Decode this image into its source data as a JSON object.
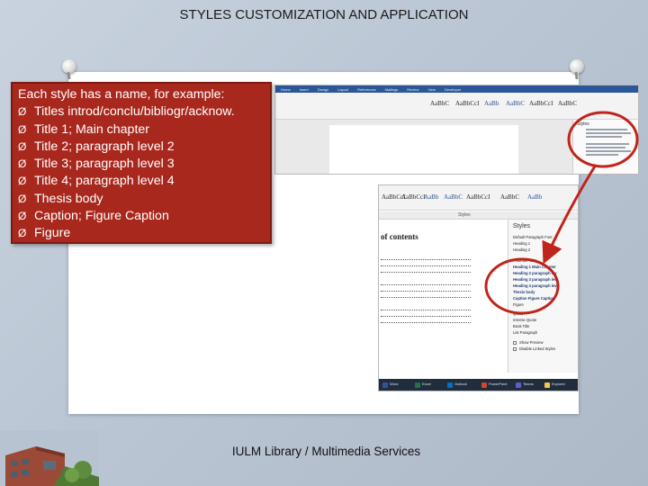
{
  "slide": {
    "title": "STYLES CUSTOMIZATION AND APPLICATION",
    "footer": "IULM Library / Multimedia Services"
  },
  "callout": {
    "intro": "Each style has a name, for example:",
    "items": [
      "Titles introd/conclu/bibliogr/acknow.",
      "Title 1; Main chapter",
      "Title 2; paragraph level 2",
      "Title 3; paragraph level 3",
      "Title 4; paragraph level 4",
      "Thesis body",
      "Caption; Figure Caption",
      "Figure"
    ],
    "bullet": "Ø",
    "color": "#a9281e"
  },
  "word1": {
    "tabs": [
      "Home",
      "Insert",
      "Design",
      "Layout",
      "References",
      "Mailings",
      "Review",
      "View",
      "Developer"
    ],
    "style_chips": [
      "AaBbC",
      "AaBbCcI",
      "AaBb",
      "AaBbC",
      "AaBbCcI",
      "AaBbC"
    ],
    "pane_title": "Styles"
  },
  "word2": {
    "toc_title": "of contents",
    "style_chips": [
      "AaBbCcI",
      "AaBbCcI",
      "AaBb",
      "AaBbC",
      "AaBbCcI",
      "AaBbC",
      "AaBb"
    ],
    "section_label": "Styles",
    "styles_pane_title": "Styles",
    "style_names": [
      "Default Paragraph Font",
      "Heading 1",
      "Heading 2",
      "Footnote Text",
      "Heading 1 Main Chapter",
      "Heading 2 paragraph lev",
      "Heading 3 paragraph lev",
      "Heading 4 paragraph lev",
      "Thesis body",
      "Caption Figure Caption",
      "Figure",
      "Quote",
      "Intense Quote",
      "Book Title",
      "List Paragraph"
    ],
    "checkboxes": [
      "Show Preview",
      "Disable Linked Styles"
    ],
    "taskbar_items": [
      "Word",
      "Excel",
      "Outlook",
      "PowerPoint",
      "Teams",
      "Explorer"
    ]
  },
  "accent_colors": {
    "red": "#c0241a",
    "word_blue": "#2b579a"
  }
}
